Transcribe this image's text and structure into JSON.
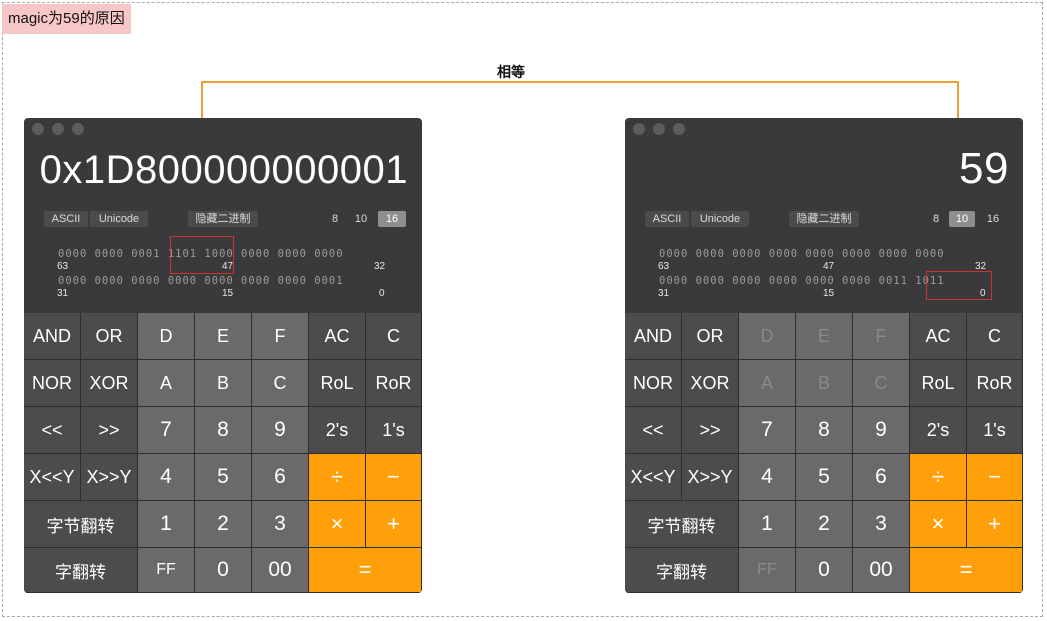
{
  "caption": "magic为59的原因",
  "equal_label": "相等",
  "colors": {
    "accent_orange": "#ff9f0a",
    "highlight_red": "#c8372c",
    "connector": "#f0a030"
  },
  "left_calc": {
    "display": "0x1D800000000001",
    "modes": {
      "ascii": "ASCII",
      "unicode": "Unicode",
      "hide_binary": "隐藏二进制"
    },
    "bases": [
      "8",
      "10",
      "16"
    ],
    "active_base": "16",
    "bits_row1": "0000 0000 0001 1101 1000 0000 0000 0000",
    "bits_row2": "0000 0000 0000 0000 0000 0000 0000 0001",
    "bit_labels_row1": [
      "63",
      "47",
      "32"
    ],
    "bit_labels_row2": [
      "31",
      "15",
      "0"
    ]
  },
  "right_calc": {
    "display": "59",
    "modes": {
      "ascii": "ASCII",
      "unicode": "Unicode",
      "hide_binary": "隐藏二进制"
    },
    "bases": [
      "8",
      "10",
      "16"
    ],
    "active_base": "10",
    "bits_row1": "0000 0000 0000 0000 0000 0000 0000 0000",
    "bits_row2": "0000 0000 0000 0000 0000 0000 0011 1011",
    "bit_labels_row1": [
      "63",
      "47",
      "32"
    ],
    "bit_labels_row2": [
      "31",
      "15",
      "0"
    ]
  },
  "keys": {
    "and": "AND",
    "or": "OR",
    "d": "D",
    "e": "E",
    "f": "F",
    "ac": "AC",
    "c_clear": "C",
    "nor": "NOR",
    "xor": "XOR",
    "a": "A",
    "b": "B",
    "c_hex": "C",
    "rol": "RoL",
    "ror": "RoR",
    "shl": "<<",
    "shr": ">>",
    "seven": "7",
    "eight": "8",
    "nine": "9",
    "twos": "2's",
    "ones": "1's",
    "xshly": "X<<Y",
    "xshry": "X>>Y",
    "four": "4",
    "five": "5",
    "six": "6",
    "divide": "÷",
    "minus": "−",
    "byte_swap": "字节翻转",
    "one": "1",
    "two": "2",
    "three": "3",
    "times": "×",
    "plus": "+",
    "word_swap": "字翻转",
    "ff": "FF",
    "zero": "0",
    "double_zero": "00",
    "equals": "="
  }
}
